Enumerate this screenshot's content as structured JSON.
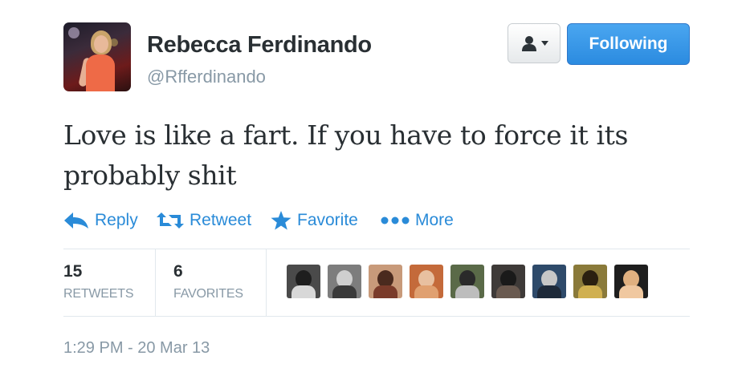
{
  "profile": {
    "display_name": "Rebecca Ferdinando",
    "handle": "@Rfferdinando"
  },
  "buttons": {
    "following_label": "Following"
  },
  "tweet": {
    "text": "Love is like a fart. If you have to force it its probably shit",
    "timestamp": "1:29 PM - 20 Mar 13"
  },
  "actions": [
    {
      "label": "Reply",
      "icon": "reply-icon"
    },
    {
      "label": "Retweet",
      "icon": "retweet-icon"
    },
    {
      "label": "Favorite",
      "icon": "star-icon"
    },
    {
      "label": "More",
      "icon": "more-dots-icon"
    }
  ],
  "stats": {
    "retweets_count": "15",
    "retweets_label": "RETWEETS",
    "favorites_count": "6",
    "favorites_label": "FAVORITES"
  },
  "colors": {
    "link_blue": "#2a8bd8",
    "follow_button": "#2b8be0",
    "text": "#292f33",
    "muted": "#8899a6"
  },
  "engaged_users_count": 9
}
